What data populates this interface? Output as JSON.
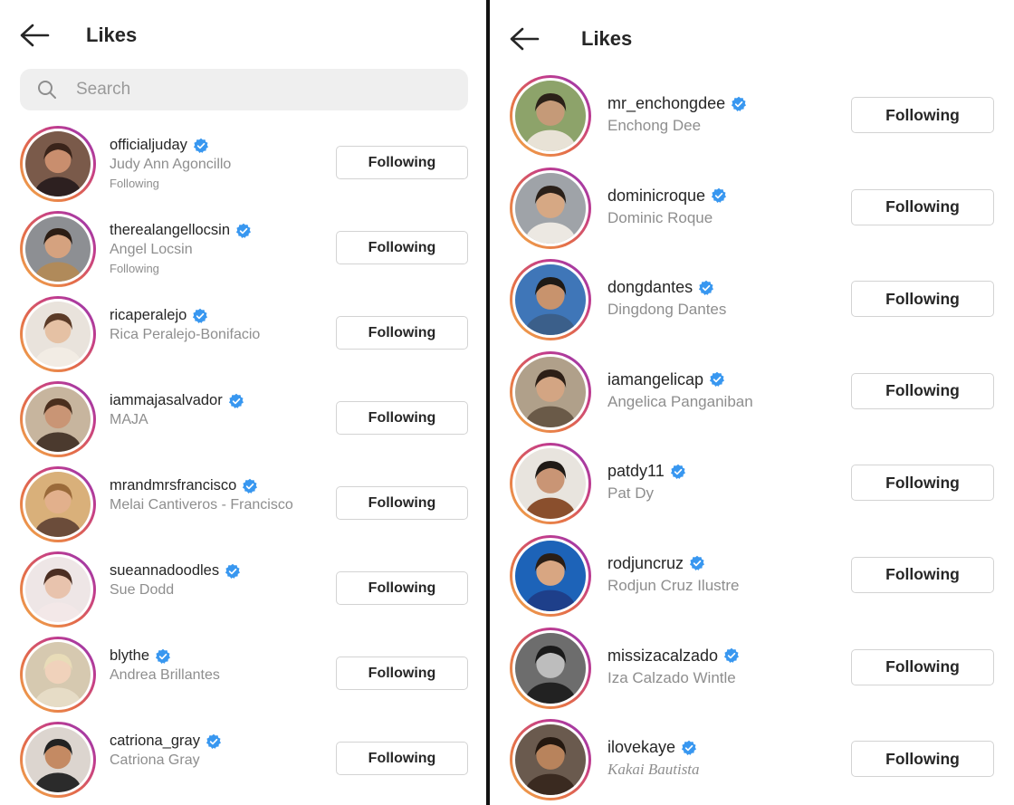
{
  "left": {
    "title": "Likes",
    "search": {
      "placeholder": "Search",
      "value": ""
    },
    "users": [
      {
        "username": "officialjuday",
        "full_name": "Judy Ann Agoncillo",
        "subtitle": "Following",
        "verified": true,
        "button": "Following"
      },
      {
        "username": "therealangellocsin",
        "full_name": "Angel Locsin",
        "subtitle": "Following",
        "verified": true,
        "button": "Following"
      },
      {
        "username": "ricaperalejo",
        "full_name": "Rica Peralejo-Bonifacio",
        "verified": true,
        "button": "Following"
      },
      {
        "username": "iammajasalvador",
        "full_name": "MAJA",
        "verified": true,
        "button": "Following"
      },
      {
        "username": "mrandmrsfrancisco",
        "full_name": "Melai Cantiveros - Francisco",
        "verified": true,
        "button": "Following"
      },
      {
        "username": "sueannadoodles",
        "full_name": "Sue Dodd",
        "verified": true,
        "button": "Following"
      },
      {
        "username": "blythe",
        "full_name": "Andrea Brillantes",
        "verified": true,
        "button": "Following"
      },
      {
        "username": "catriona_gray",
        "full_name": "Catriona Gray",
        "verified": true,
        "button": "Following"
      }
    ]
  },
  "right": {
    "title": "Likes",
    "users": [
      {
        "username": "mr_enchongdee",
        "full_name": "Enchong Dee",
        "verified": true,
        "button": "Following"
      },
      {
        "username": "dominicroque",
        "full_name": "Dominic Roque",
        "verified": true,
        "button": "Following"
      },
      {
        "username": "dongdantes",
        "full_name": "Dingdong Dantes",
        "verified": true,
        "button": "Following"
      },
      {
        "username": "iamangelicap",
        "full_name": "Angelica Panganiban",
        "verified": true,
        "button": "Following"
      },
      {
        "username": "patdy11",
        "full_name": "Pat Dy",
        "verified": true,
        "button": "Following"
      },
      {
        "username": "rodjuncruz",
        "full_name": "Rodjun Cruz Ilustre",
        "verified": true,
        "button": "Following"
      },
      {
        "username": "missizacalzado",
        "full_name": "Iza Calzado Wintle",
        "verified": true,
        "button": "Following"
      },
      {
        "username": "ilovekaye",
        "full_name": "Kakai Bautista",
        "verified": true,
        "button": "Following",
        "name_style": "italic"
      }
    ]
  },
  "colors": {
    "verified_badge": "#3897f0",
    "secondary_text": "#8e8e8e",
    "button_border": "#d3d3d3",
    "search_bg": "#efefef",
    "ring_gradient": [
      "#f2b04c",
      "#e36b4a",
      "#c43c8a",
      "#8a3ab9"
    ]
  },
  "icons": {
    "back": "arrow-left-icon",
    "search": "search-icon",
    "verified": "verified-badge-icon"
  }
}
